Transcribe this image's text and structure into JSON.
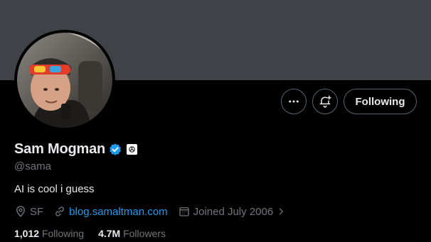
{
  "profile": {
    "display_name": "Sam Mogman",
    "handle": "@sama",
    "bio": "AI is cool i guess",
    "location": "SF",
    "website": "blog.samaltman.com",
    "joined": "Joined July 2006"
  },
  "actions": {
    "following_label": "Following"
  },
  "stats": {
    "following_count": "1,012",
    "following_label": "Following",
    "followers_count": "4.7M",
    "followers_label": "Followers"
  },
  "colors": {
    "accent": "#1d9bf0",
    "banner": "#3f4246",
    "muted_text": "#71767b",
    "text": "#e7e9ea",
    "background": "#000000"
  },
  "icons": {
    "more": "more-horizontal-icon",
    "notify": "bell-plus-icon",
    "verified": "verified-badge-icon",
    "affiliate": "openai-logo-icon",
    "location": "location-pin-icon",
    "link": "link-icon",
    "calendar": "calendar-icon"
  }
}
